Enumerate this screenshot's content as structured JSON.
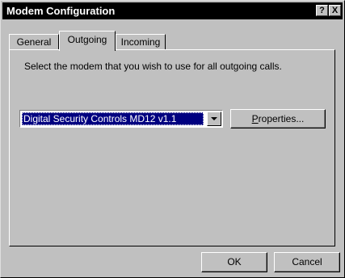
{
  "window": {
    "title": "Modem Configuration",
    "help_label": "?",
    "close_label": "X"
  },
  "tabs": [
    {
      "label": "General",
      "active": false
    },
    {
      "label": "Outgoing",
      "active": true
    },
    {
      "label": "Incoming",
      "active": false
    }
  ],
  "outgoing": {
    "description": "Select the modem that you wish to use for all outgoing calls.",
    "modem_select_value": "Digital Security Controls MD12 v1.1",
    "properties_button": {
      "accel": "P",
      "rest": "roperties..."
    }
  },
  "footer": {
    "ok_label": "OK",
    "cancel_label": "Cancel"
  }
}
